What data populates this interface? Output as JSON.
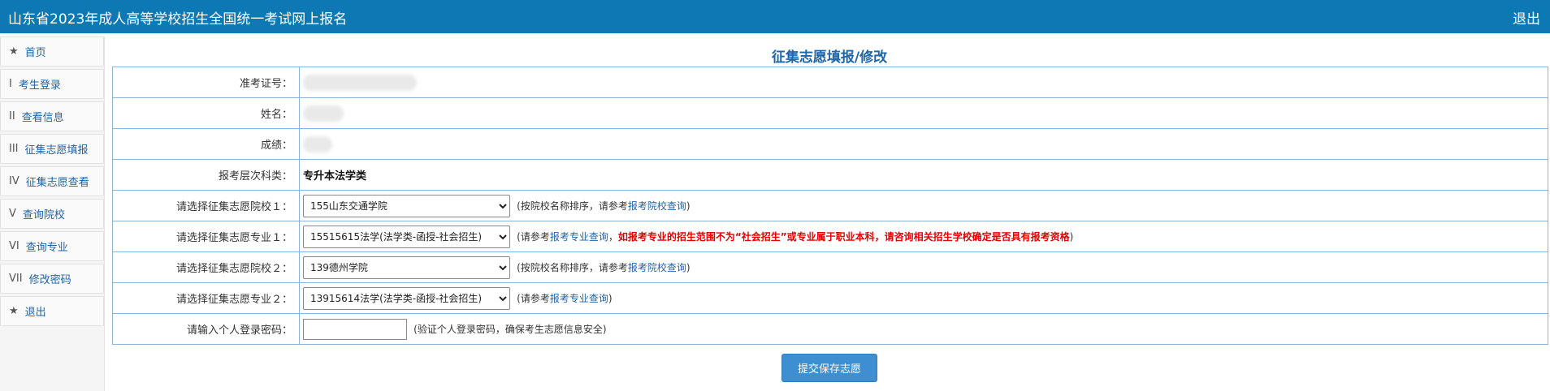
{
  "header": {
    "title": "山东省2023年成人高等学校招生全国统一考试网上报名",
    "logout": "退出",
    "bg_color": "#0c79b5"
  },
  "sidebar": {
    "items": [
      {
        "num": "★",
        "label": "首页"
      },
      {
        "num": "I",
        "label": "考生登录"
      },
      {
        "num": "II",
        "label": "查看信息"
      },
      {
        "num": "III",
        "label": "征集志愿填报"
      },
      {
        "num": "IV",
        "label": "征集志愿查看"
      },
      {
        "num": "V",
        "label": "查询院校"
      },
      {
        "num": "VI",
        "label": "查询专业"
      },
      {
        "num": "VII",
        "label": "修改密码"
      },
      {
        "num": "★",
        "label": "退出"
      }
    ]
  },
  "main": {
    "title": "征集志愿填报/修改",
    "form": {
      "exam_no_label": "准考证号：",
      "name_label": "姓名：",
      "score_label": "成绩：",
      "level_label": "报考层次科类：",
      "level_value": "专升本法学类",
      "school1_label": "请选择征集志愿院校１：",
      "school1_value": "155山东交通学院",
      "school1_hint_pre": "(按院校名称排序，请参考",
      "school1_hint_link": "报考院校查询",
      "school1_hint_post": ")",
      "major1_label": "请选择征集志愿专业１：",
      "major1_value": "15515615法学(法学类-函授-社会招生)",
      "major1_hint_pre": "(请参考",
      "major1_hint_link": "报考专业查询",
      "major1_hint_mid": "，",
      "major1_warning": "如报考专业的招生范围不为“社会招生”或专业属于职业本科，请咨询相关招生学校确定是否具有报考资格",
      "major1_hint_post": ")",
      "school2_label": "请选择征集志愿院校２：",
      "school2_value": "139德州学院",
      "school2_hint_pre": "(按院校名称排序，请参考",
      "school2_hint_link": "报考院校查询",
      "school2_hint_post": ")",
      "major2_label": "请选择征集志愿专业２：",
      "major2_value": "13915614法学(法学类-函授-社会招生)",
      "major2_hint_pre": "(请参考",
      "major2_hint_link": "报考专业查询",
      "major2_hint_post": ")",
      "password_label": "请输入个人登录密码：",
      "password_hint": "(验证个人登录密码，确保考生志愿信息安全)"
    },
    "submit_label": "提交保存志愿"
  }
}
